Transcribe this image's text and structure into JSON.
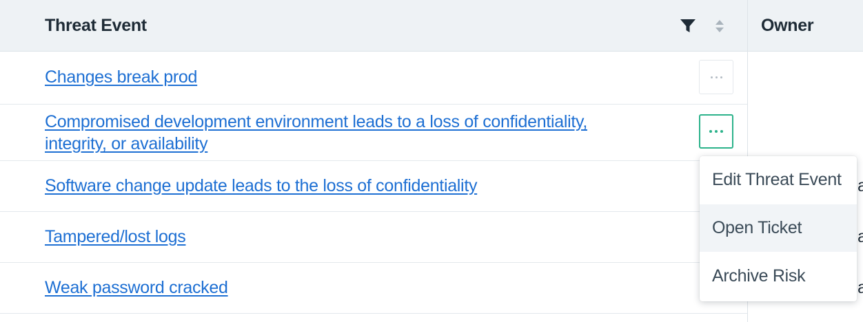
{
  "header": {
    "threat_event": "Threat Event",
    "owner": "Owner"
  },
  "rows": [
    {
      "title": "Changes break prod"
    },
    {
      "title": "Compromised development environment leads to a loss of confidentiality,",
      "title_line2": "integrity, or availability"
    },
    {
      "title": "Software change update leads to the loss of confidentiality",
      "owner_fragment": "a"
    },
    {
      "title": "Tampered/lost logs",
      "owner_fragment": "a"
    },
    {
      "title": "Weak password cracked",
      "owner_fragment": "a"
    }
  ],
  "context_menu": {
    "items": [
      {
        "label": "Edit Threat Event"
      },
      {
        "label": "Open Ticket"
      },
      {
        "label": "Archive Risk"
      }
    ],
    "hovered_index": 1
  },
  "colors": {
    "link": "#1d6fd3",
    "accent": "#2bb28a",
    "header_bg": "#eef2f5"
  },
  "icons": [
    "filter-icon",
    "sort-icon",
    "more-options-icon"
  ]
}
